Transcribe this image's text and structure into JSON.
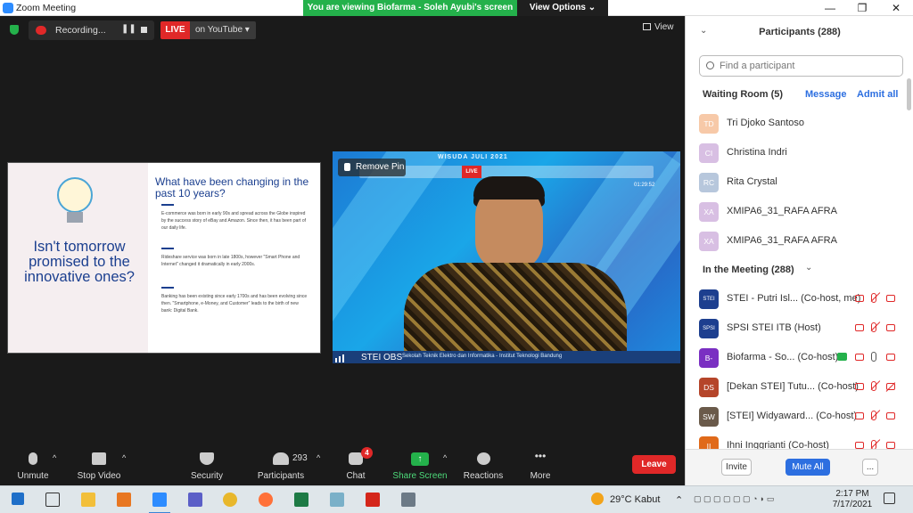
{
  "window": {
    "title": "Zoom Meeting",
    "minimize": "—",
    "restore": "❐",
    "close": "✕"
  },
  "banner": {
    "text": "You are viewing Biofarma - Soleh Ayubi's screen",
    "options_label": "View Options ⌄"
  },
  "meeting_bar": {
    "recording_label": "Recording...",
    "pause_icon": "❚❚",
    "live_label": "LIVE",
    "live_target": "on YouTube ▾",
    "view_label": "View"
  },
  "slide": {
    "question": "Isn't tomorrow promised to the innovative ones?",
    "title": "What have been changing in the past 10 years?",
    "paragraphs": [
      "E-commerce was born in early 90s and spread across the Globe inspired by the success story of eBay and Amazon. Since then, it has been part of our daily life.",
      "Rideshare service was born in late 1800s, however \"Smart Phone and Internet\" changed it dramatically in early 2000s.",
      "Banking has been existing since early 1700s and has been evolving since then. \"Smartphone, e-Money, and Customer\" leads to the birth of new bank: Digital Bank."
    ]
  },
  "video": {
    "remove_pin": "Remove Pin",
    "banner": "WISUDA JULI 2021",
    "inner_live": "LIVE",
    "inner_time": "01:29:52",
    "participant_name": "STEI OBS",
    "ticker": "Sekolah Teknik Elektro dan Informatika - Institut Teknologi Bandung"
  },
  "toolbar": {
    "unmute": "Unmute",
    "stop_video": "Stop Video",
    "security": "Security",
    "participants": "Participants",
    "participants_count": "293",
    "chat": "Chat",
    "chat_badge": "4",
    "share_screen": "Share Screen",
    "reactions": "Reactions",
    "more": "More",
    "more_icon": "•••",
    "leave": "Leave",
    "caret": "^"
  },
  "participants_panel": {
    "title": "Participants (288)",
    "collapse_icon": "⌄",
    "search_placeholder": "Find a participant",
    "waiting_room_label": "Waiting Room (5)",
    "message_link": "Message",
    "admit_all_link": "Admit all",
    "waiting": [
      {
        "initials": "TD",
        "name": "Tri Djoko Santoso",
        "color": "#f7c9a8"
      },
      {
        "initials": "CI",
        "name": "Christina Indri",
        "color": "#d8bfe3"
      },
      {
        "initials": "RC",
        "name": "Rita Crystal",
        "color": "#b7c7dc"
      },
      {
        "initials": "XA",
        "name": "XMIPA6_31_RAFA AFRA",
        "color": "#d8bfe3"
      },
      {
        "initials": "XA",
        "name": "XMIPA6_31_RAFA AFRA",
        "color": "#d8bfe3"
      }
    ],
    "in_meeting_label": "In the Meeting (288)",
    "in_meeting": [
      {
        "initials": "STEI",
        "name": "STEI - Putri Isl... (Co-host, me)",
        "color": "#1d3f8f",
        "mic_off": true,
        "cam_off": false,
        "sharing": false
      },
      {
        "initials": "SPSI",
        "name": "SPSI STEI ITB (Host)",
        "color": "#1d3f8f",
        "mic_off": true,
        "cam_off": false,
        "sharing": false
      },
      {
        "initials": "B-",
        "name": "Biofarma - So... (Co-host)",
        "color": "#7a2fc2",
        "mic_off": false,
        "cam_off": false,
        "sharing": true
      },
      {
        "initials": "DS",
        "name": "[Dekan STEI] Tutu... (Co-host)",
        "color": "#b5452a",
        "mic_off": true,
        "cam_off": true,
        "sharing": false
      },
      {
        "initials": "SW",
        "name": "[STEI] Widyaward... (Co-host)",
        "color": "#6a5a4a",
        "mic_off": true,
        "cam_off": false,
        "sharing": false
      },
      {
        "initials": "II",
        "name": "Ihni Inggrianti (Co-host)",
        "color": "#e06a1a",
        "mic_off": true,
        "cam_off": false,
        "sharing": false
      }
    ],
    "invite": "Invite",
    "mute_all": "Mute All",
    "more": "..."
  },
  "taskbar": {
    "weather": "29°C  Kabut",
    "time": "2:17 PM",
    "date": "7/17/2021"
  }
}
